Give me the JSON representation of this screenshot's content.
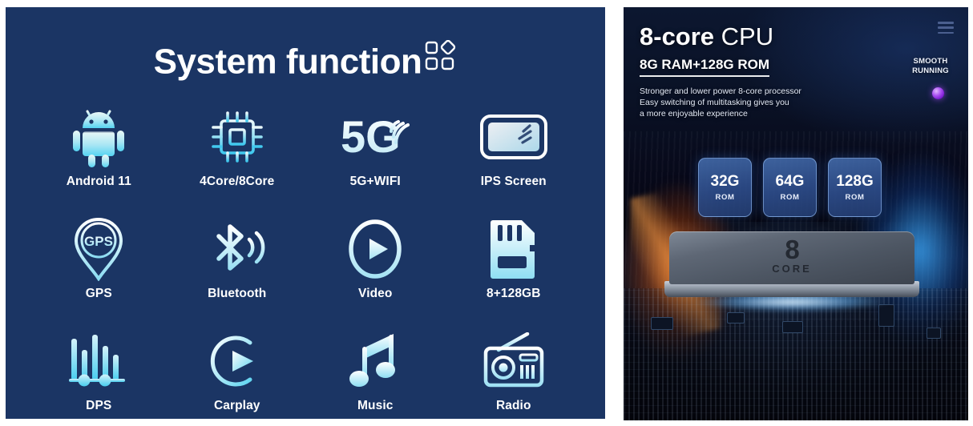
{
  "left_panel": {
    "title": "System function",
    "title_icon": "grid-diamond-icon",
    "features": [
      {
        "label": "Android 11",
        "icon": "android-robot-icon"
      },
      {
        "label": "4Core/8Core",
        "icon": "cpu-chip-icon"
      },
      {
        "label": "5G+WIFI",
        "icon": "5g-wifi-icon"
      },
      {
        "label": "IPS Screen",
        "icon": "ips-screen-icon"
      },
      {
        "label": "GPS",
        "icon": "gps-pin-icon"
      },
      {
        "label": "Bluetooth",
        "icon": "bluetooth-icon"
      },
      {
        "label": "Video",
        "icon": "video-play-icon"
      },
      {
        "label": "8+128GB",
        "icon": "sd-card-icon"
      },
      {
        "label": "DPS",
        "icon": "equalizer-icon"
      },
      {
        "label": "Carplay",
        "icon": "carplay-icon"
      },
      {
        "label": "Music",
        "icon": "music-note-icon"
      },
      {
        "label": "Radio",
        "icon": "radio-icon"
      }
    ]
  },
  "right_panel": {
    "title_strong": "8-core",
    "title_light": " CPU",
    "subtitle": "8G RAM+128G ROM",
    "description": "Stronger and lower power 8-core processor\nEasy switching of multitasking gives you\na more enjoyable experience",
    "menu_icon": "hamburger-menu-icon",
    "badge_text": "SMOOTH\nRUNNING",
    "status_dot": "purple-glow-dot",
    "rom_cards": [
      {
        "size": "32G",
        "unit": "ROM"
      },
      {
        "size": "64G",
        "unit": "ROM"
      },
      {
        "size": "128G",
        "unit": "ROM"
      }
    ],
    "chip": {
      "number": "8",
      "word": "CORE"
    }
  },
  "colors": {
    "left_bg": "#1b3564",
    "icon_cyan": "#5fd8f5",
    "icon_pale": "#e8f6fb",
    "text_white": "#ffffff",
    "accent_purple": "#a84df0",
    "glow_orange": "#ff7b1e",
    "glow_blue": "#3caaff"
  }
}
